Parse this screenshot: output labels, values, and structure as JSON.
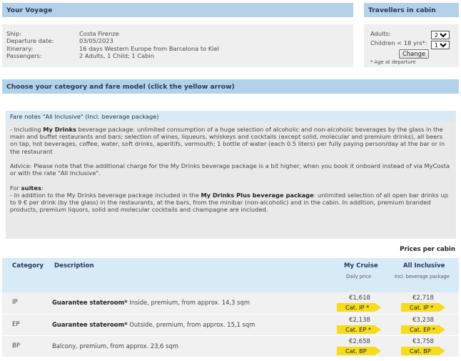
{
  "voyage": {
    "title": "Your Voyage",
    "fields": [
      {
        "label": "Ship:",
        "value": "Costa Firenze"
      },
      {
        "label": "Departure date:",
        "value": "03/05/2023"
      },
      {
        "label": "Itinerary:",
        "value": "16 days Western Europe from Barcelona to Kiel"
      },
      {
        "label": "Passengers:",
        "value": "2 Adults, 1 Child; 1 Cabin"
      }
    ]
  },
  "travellers": {
    "title": "Travellers in cabin",
    "adults_label": "Adults:",
    "adults_value": "2",
    "children_label": "Children < 18 yrs*:",
    "children_value": "1",
    "change_label": "Change",
    "note": "* Age at departure"
  },
  "category_header": "Choose your category and fare model (click the yellow arrow)",
  "fare_notes": {
    "title": "Fare notes \"All Inclusive\" (Incl. beverage package)",
    "p1_pre": "- Including ",
    "p1_bold": "My Drinks",
    "p1_post": " beverage package: unlimited consumption of a huge selection of alcoholic and non-alcoholic beverages by the glass in the main and buffet restaurants and bars; selection of wines, liqueurs, whiskeys and cocktails (except solid, molecular and premium drinks), all beers on tap, hot beverages, coffee, water, soft drinks, aperitifs, vermouth; 1 bottle of water (each 0.5 liters) per fully paying person/day at the bar or in the restaurant",
    "p2": "Advice: Please note that the additional charge for the My Drinks beverage package is a bit higher, when you book it onboard instead of via MyCosta or with the rate \"All Inclusive\".",
    "p3_pre": "For ",
    "p3_bold": "suites",
    "p3_post": ":",
    "p4_pre": "- In addition to the My Drinks beverage package included in the ",
    "p4_bold": "My Drinks Plus beverage package",
    "p4_post": ": unlimited selection of all open bar drinks up to 9 € per drink (by the glass) in the restaurants, at the bars, from the minibar (non-alcoholic) and in the cabin. In addition, premium branded products, premium liquors, solid and molecular cocktails and champagne are included."
  },
  "prices_label": "Prices per cabin",
  "table": {
    "col_category": "Category",
    "col_description": "Description",
    "col_mycruise": "My Cruise",
    "col_mycruise_sub": "Daily price",
    "col_allinc": "All Inclusive",
    "col_allinc_sub": "Incl. beverage package",
    "rows": [
      {
        "cat": "IP",
        "desc_bold": "Guarantee stateroom*",
        "desc": " Inside, premium, from approx. 14,3 sqm",
        "p1": "€1,618",
        "b1": "Cat. IP *",
        "p2": "€2,718",
        "b2": "Cat. IP *"
      },
      {
        "cat": "EP",
        "desc_bold": "Guarantee stateroom*",
        "desc": " Outside, premium, from approx. 15,1 sqm",
        "p1": "€2,138",
        "b1": "Cat. EP *",
        "p2": "€3,238",
        "b2": "Cat. EP *"
      },
      {
        "cat": "BP",
        "desc_bold": "",
        "desc": "Balcony, premium, from approx. 23,6 sqm",
        "p1": "€2,658",
        "b1": "Cat. BP",
        "p2": "€3,758",
        "b2": "Cat. BP"
      }
    ]
  }
}
